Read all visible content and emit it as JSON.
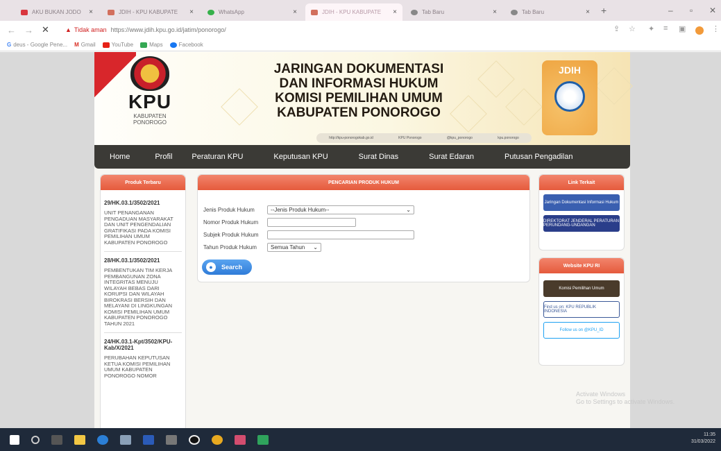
{
  "browser": {
    "tabs": [
      {
        "label": "AKU BUKAN JODO",
        "color": "#d9363e"
      },
      {
        "label": "JDIH - KPU KABUPATE",
        "color": "#d26f5d"
      },
      {
        "label": "WhatsApp",
        "color": "#36b04a"
      },
      {
        "label": "JDIH - KPU KABUPATE",
        "color": "#d26f5d"
      },
      {
        "label": "Tab Baru",
        "color": "#888888"
      },
      {
        "label": "Tab Baru",
        "color": "#888888"
      }
    ],
    "add_tab": "+",
    "security_label": "Tidak aman",
    "url": "https://www.jdih.kpu.go.id/jatim/ponorogo/",
    "bookmarks": [
      "deus - Google Pene...",
      "Gmail",
      "YouTube",
      "Maps",
      "Facebook"
    ]
  },
  "site": {
    "title_lines": [
      "JARINGAN DOKUMENTASI",
      "DAN INFORMASI HUKUM",
      "KOMISI PEMILIHAN UMUM",
      "KABUPATEN PONOROGO"
    ],
    "logo_text": "KPU",
    "logo_sub_lines": [
      "KABUPATEN",
      "PONOROGO"
    ],
    "jdih_logo_text": "JDIH",
    "social": [
      "http://kpu-ponorogokab.go.id",
      "KPU Ponorogo",
      "@kpu_ponorogo",
      "kpu.ponorogo"
    ],
    "menu": [
      "Home",
      "Profil",
      "Peraturan KPU",
      "Keputusan KPU",
      "Surat Dinas",
      "Surat Edaran",
      "Putusan Pengadilan"
    ],
    "produk_terbaru": {
      "header": "Produk Terbaru",
      "items": [
        {
          "id": "29/HK.03.1/3502/2021",
          "text": "UNIT PENANGANAN PENGADUAN MASYARAKAT DAN UNIT PENGENDALIAN GRATIFIKASI PADA KOMISI PEMILIHAN UMUM KABUPATEN PONOROGO"
        },
        {
          "id": "28/HK.03.1/3502/2021",
          "text": "PEMBENTUKAN TIM KERJA PEMBANGUNAN ZONA INTEGRITAS MENUJU WILAYAH BEBAS DARI KORUPSI DAN WILAYAH BIROKRASI BERSIH DAN MELAYANI DI LINGKUNGAN KOMISI PEMILIHAN UMUM KABUPATEN PONOROGO TAHUN 2021"
        },
        {
          "id": "24/HK.03.1-Kpt/3502/KPU-Kab/X/2021",
          "text": "PERUBAHAN KEPUTUSAN KETUA KOMISI PEMILIHAN UMUM KABUPATEN PONOROGO NOMOR"
        }
      ]
    },
    "search": {
      "header": "PENCARIAN PRODUK HUKUM",
      "jenis_label": "Jenis Produk Hukum",
      "jenis_value": "--Jenis Produk Hukum--",
      "nomor_label": "Nomor Produk Hukum",
      "subjek_label": "Subjek Produk Hukum",
      "tahun_label": "Tahun Produk Hukum",
      "tahun_value": "Semua Tahun",
      "button": "Search"
    },
    "link_terkait": {
      "header": "Link Terkait",
      "links": [
        "Jaringan Dokumentasi Informasi Hukum",
        "DIREKTORAT JENDERAL PERATURAN PERUNDANG-UNDANGAN"
      ]
    },
    "website_kpu": {
      "header": "Website KPU RI",
      "links": [
        "Komisi Pemilihan Umum",
        "Find us on: KPU REPUBLIK INDONESIA",
        "Follow us on @KPU_ID"
      ]
    }
  },
  "watermark": [
    "Activate Windows",
    "Go to Settings to activate Windows."
  ],
  "taskbar": {
    "time": "11:35",
    "date": "31/03/2022"
  }
}
